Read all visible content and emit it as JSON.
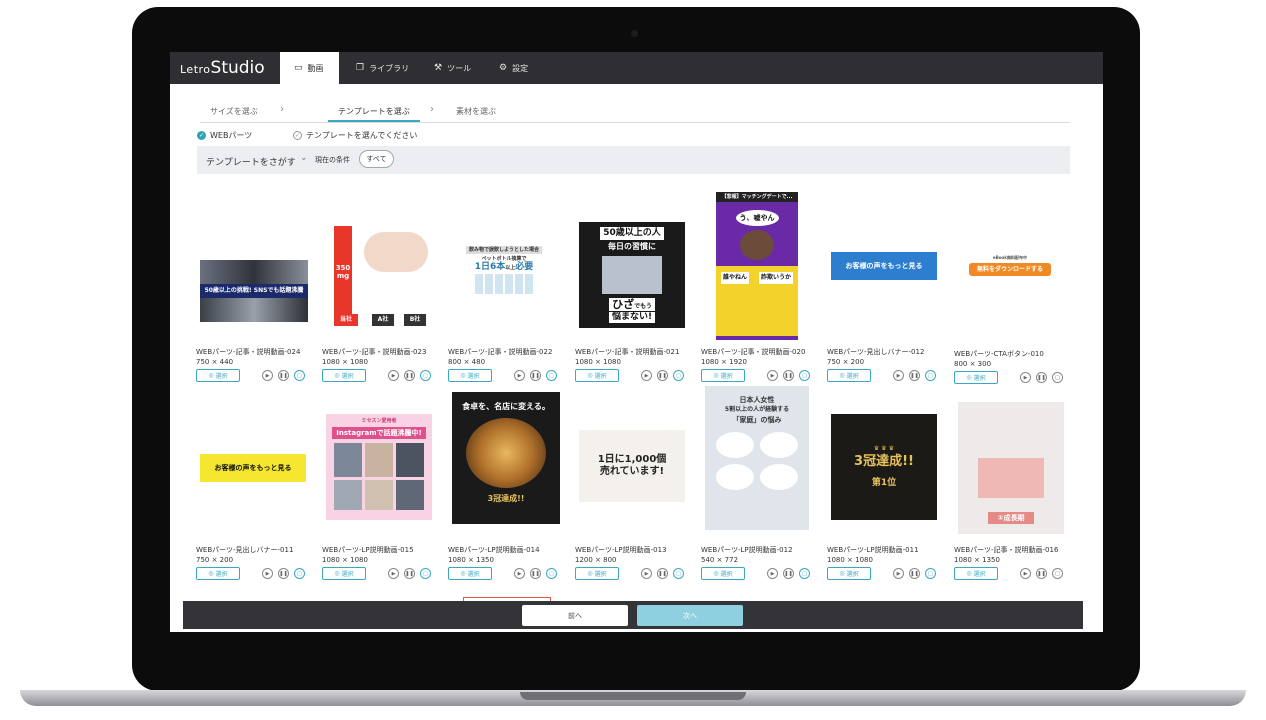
{
  "brand": {
    "prefix": "Letro",
    "main": "Studio"
  },
  "nav": {
    "tabs": [
      {
        "label": "動画",
        "icon": "video-icon"
      },
      {
        "label": "ライブラリ",
        "icon": "library-icon"
      },
      {
        "label": "ツール",
        "icon": "wrench-icon"
      },
      {
        "label": "設定",
        "icon": "gear-icon"
      }
    ]
  },
  "steps": {
    "items": [
      {
        "label": "サイズを選ぶ"
      },
      {
        "label": "テンプレートを選ぶ"
      },
      {
        "label": "素材を選ぶ"
      }
    ]
  },
  "status": {
    "size": "WEBパーツ",
    "template": "テンプレートを選んでください"
  },
  "search": {
    "label": "テンプレートをさがす",
    "condition_label": "現在の条件",
    "chip": "すべて"
  },
  "select_label": "選択",
  "row1": [
    {
      "title": "WEBパーツ-記事・説明動画-024",
      "size": "750 × 440",
      "caption": "50歳以上の挑戦! SNSでも話題沸騰"
    },
    {
      "title": "WEBパーツ-記事・説明動画-023",
      "size": "1080 × 1080",
      "l1": "350",
      "l1b": "mg",
      "l2": "当社",
      "l3": "A社",
      "l4": "B社"
    },
    {
      "title": "WEBパーツ-記事・説明動画-022",
      "size": "800 × 480",
      "l1": "飲み物で誤飲しようとした場合",
      "l2": "ペットボトル換算で",
      "l3": "1日6本",
      "l4": "以上",
      "l5": "必要"
    },
    {
      "title": "WEBパーツ-記事・説明動画-021",
      "size": "1080 × 1080",
      "l1": "50歳以上の人",
      "l2": "毎日の習慣に",
      "l3": "ひざ",
      "l4": "でもう",
      "l5": "悩まない!"
    },
    {
      "title": "WEBパーツ-記事・説明動画-020",
      "size": "1080 × 1920",
      "l1": "【悲報】マッチングデートで...",
      "l2": "う、嘘やん",
      "l3": "誰やねん",
      "l4": "詐欺いうか"
    },
    {
      "title": "WEBパーツ-見出しバナー-012",
      "size": "750 × 200",
      "l1": "お客様の声をもっと見る"
    },
    {
      "title": "WEBパーツ-CTAボタン-010",
      "size": "800 × 300",
      "l1": "eBook無料配布中",
      "l2": "無料をダウンロードする"
    }
  ],
  "row2": [
    {
      "title": "WEBパーツ-見出しバナー-011",
      "size": "750 × 200",
      "l1": "お客様の声をもっと見る"
    },
    {
      "title": "WEBパーツ-LP説明動画-015",
      "size": "1080 × 1080",
      "l1": "ミセスン愛用者",
      "l2": "Instagramで話題沸騰中!"
    },
    {
      "title": "WEBパーツ-LP説明動画-014",
      "size": "1080 × 1350",
      "l1": "食卓を、名店に変える。",
      "l2": "3冠達成!!"
    },
    {
      "title": "WEBパーツ-LP説明動画-013",
      "size": "1200 × 800",
      "l1": "1日に1,000個",
      "l2": "売れています!"
    },
    {
      "title": "WEBパーツ-LP説明動画-012",
      "size": "540 × 772",
      "l1": "日本人女性",
      "l2": "5割以上の人が経験する",
      "l3": "「家庭」の悩み"
    },
    {
      "title": "WEBパーツ-LP説明動画-011",
      "size": "1080 × 1080",
      "l1": "3冠達成!!",
      "l2": "第1位"
    },
    {
      "title": "WEBパーツ-記事・説明動画-016",
      "size": "1080 × 1350",
      "l1": "①成長期"
    }
  ],
  "footer": {
    "prev": "前へ",
    "next": "次へ"
  },
  "colors": {
    "accent": "#3aa8c1",
    "appbar": "#2f2f33",
    "footer": "#333338"
  }
}
